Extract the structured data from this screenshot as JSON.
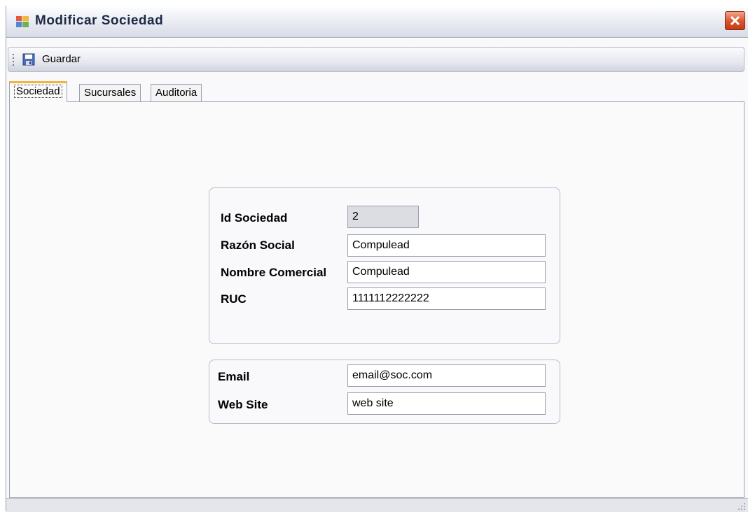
{
  "window": {
    "title": "Modificar Sociedad",
    "accent": "#f2b53d",
    "close_color": "#d9532c"
  },
  "toolbar": {
    "save_label": "Guardar",
    "save_icon": "floppy-disk-icon"
  },
  "tabs": [
    {
      "label": "Sociedad",
      "active": true
    },
    {
      "label": "Sucursales",
      "active": false
    },
    {
      "label": "Auditoria",
      "active": false
    }
  ],
  "company_group": {
    "id_label": "Id Sociedad",
    "id_value": "2",
    "business_name_label": "Razón Social",
    "business_name_value": "Compulead",
    "trade_name_label": "Nombre Comercial",
    "trade_name_value": "Compulead",
    "ruc_label": "RUC",
    "ruc_value": "1111112222222"
  },
  "contact_group": {
    "email_label": "Email",
    "email_value": "email@soc.com",
    "website_label": "Web Site",
    "website_value": "web site"
  }
}
